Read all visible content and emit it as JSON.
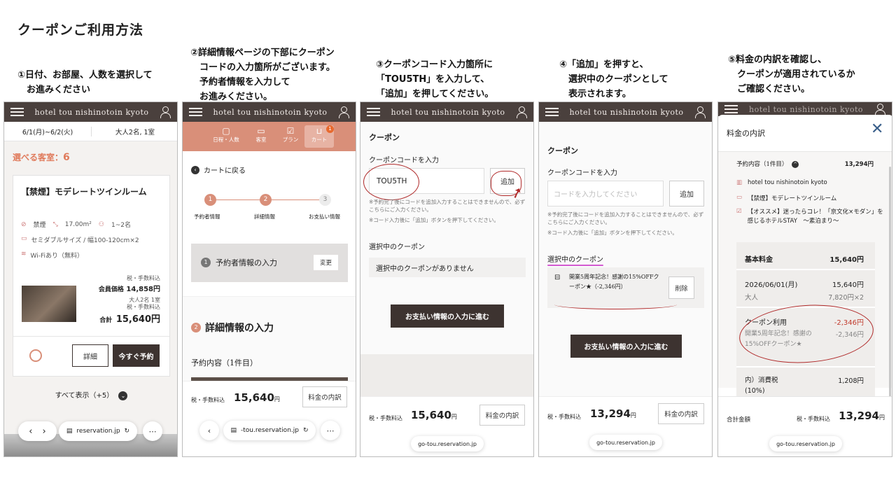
{
  "title": "クーポンご利用方法",
  "captions": [
    "①日付、お部屋、人数を選択して\n　お進みください",
    "②詳細情報ページの下部にクーポン\n　コードの入力箇所がございます。\n　予約者情報を入力して\n　お進みください。",
    "③クーポンコード入力箇所に\n「TOU5TH」を入力して、\n「追加」を押してください。",
    "④「追加」を押すと、\n　選択中のクーポンとして\n　表示されます。",
    "⑤料金の内訳を確認し、\n　クーポンが適用されているか\n　ご確認ください。"
  ],
  "hotel_name": "hotel tou nishinotoin kyoto",
  "s1": {
    "dates": "6/1(月)~6/2(火)",
    "guests": "大人2名, 1室",
    "rooms_label": "選べる客室：",
    "rooms_count": "6",
    "room_name": "【禁煙】モデレートツインルーム",
    "nosmoke": "禁煙",
    "area": "17.00m²",
    "capacity": "1~2名",
    "bed": "セミダブルサイズ / 幅100-120cm×2",
    "wifi": "Wi-Fiあり（無料）",
    "tax_note": "税・手数料込",
    "member_label": "会員価格",
    "member_price": "14,858円",
    "breakdown1": "大人2名 1室",
    "breakdown2": "税・手数料込",
    "total_label": "合計",
    "total_price": "15,640円",
    "detail_btn": "詳細",
    "book_btn": "今すぐ予約",
    "show_all": "すべて表示（+5）",
    "url": "reservation.jp"
  },
  "s2": {
    "tabs": [
      "日程・人数",
      "客室",
      "プラン",
      "カート"
    ],
    "cart_badge": "1",
    "back": "カートに戻る",
    "steps": [
      "予約者情報",
      "詳細情報",
      "お支払い情報"
    ],
    "step_nums": [
      "1",
      "2",
      "3"
    ],
    "sec1": "予約者情報の入力",
    "sec1_num": "1",
    "change": "変更",
    "sec2": "詳細情報の入力",
    "sec2_num": "2",
    "booking": "予約内容（1件目）",
    "tax": "税・手数料込",
    "price": "15,640",
    "yen": "円",
    "breakdown_btn": "料金の内訳",
    "url": "-tou.reservation.jp"
  },
  "s3": {
    "coupon_h": "クーポン",
    "code_label": "クーポンコードを入力",
    "code_value": "TOU5TH",
    "add_btn": "追加",
    "note1": "※予約完了後にコードを追加入力することはできませんので、必ずこちらにご入力ください。",
    "note2": "※コード入力後に「追加」ボタンを押下してください。",
    "selected_h": "選択中のクーポン",
    "none": "選択中のクーポンがありません",
    "proceed": "お支払い情報の入力に進む",
    "tax": "税・手数料込",
    "price": "15,640",
    "yen": "円",
    "breakdown_btn": "料金の内訳",
    "url": "go-tou.reservation.jp"
  },
  "s4": {
    "coupon_h": "クーポン",
    "code_label": "クーポンコードを入力",
    "placeholder": "コードを入力してください",
    "add_btn": "追加",
    "note1": "※予約完了後にコードを追加入力することはできませんので、必ずこちらにご入力ください。",
    "note2": "※コード入力後に「追加」ボタンを押下してください。",
    "selected_h": "選択中のクーポン",
    "coupon_text": "開業5周年記念！感謝の15%OFFクーポン★（-2,346円）",
    "delete_btn": "削除",
    "proceed": "お支払い情報の入力に進む",
    "tax": "税・手数料込",
    "price": "13,294",
    "yen": "円",
    "breakdown_btn": "料金の内訳",
    "url": "go-tou.reservation.jp"
  },
  "s5": {
    "modal_title": "料金の内訳",
    "booking": "予約内容（1件目）",
    "booking_total": "13,294円",
    "hotel": "hotel tou nishinotoin kyoto",
    "room": "【禁煙】モデレートツインルーム",
    "plan": "【オススメ】迷ったらコレ！「京文化×モダン」を感じるホテルSTAY　～素泊まり～",
    "base_label": "基本料金",
    "base_price": "15,640円",
    "date": "2026/06/01(月)",
    "date_price": "15,640円",
    "adult": "大人",
    "adult_price": "7,820円×2",
    "coupon_label": "クーポン利用",
    "coupon_amount": "-2,346円",
    "coupon_name": "開業5周年記念！感謝の15%OFFクーポン★",
    "coupon_amount2": "-2,346円",
    "tax_label": "内）消費税(10%)",
    "tax_amount": "1,208円",
    "total_label": "合計金額",
    "tax": "税・手数料込",
    "price": "13,294",
    "yen": "円",
    "url": "go-tou.reservation.jp"
  },
  "colors": {
    "header_bg": "#4a403d",
    "accent_orange": "#e07b5c",
    "coupon_red": "#c0392b",
    "dark_button": "#3d3330",
    "salmon_tabs": "#d98f79"
  }
}
